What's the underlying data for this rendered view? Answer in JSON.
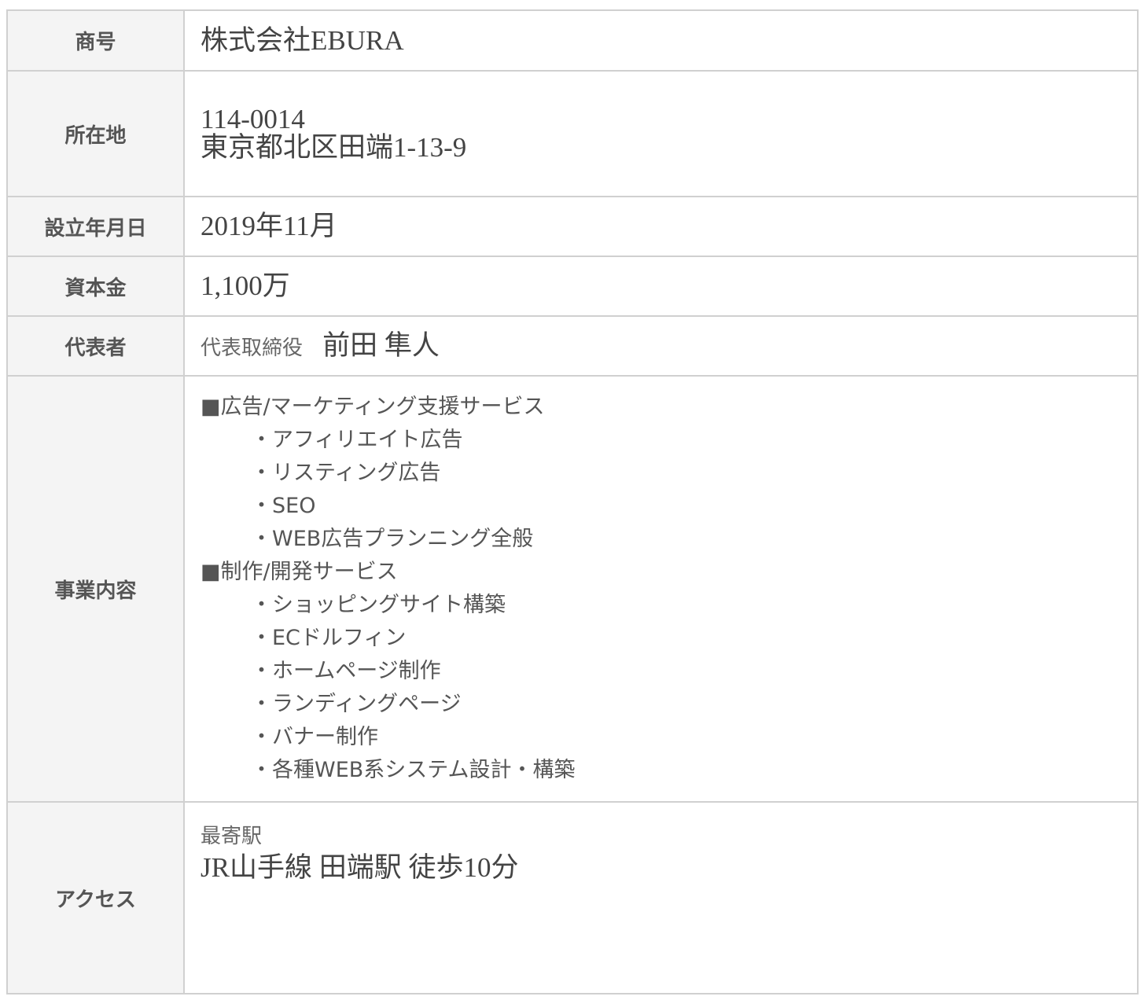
{
  "rows": {
    "name": {
      "label": "商号",
      "value": "株式会社EBURA"
    },
    "address": {
      "label": "所在地",
      "postal": "114-0014",
      "street": "東京都北区田端1-13-9"
    },
    "founded": {
      "label": "設立年月日",
      "value": "2019年11月"
    },
    "capital": {
      "label": "資本金",
      "value": "1,100万"
    },
    "representative": {
      "label": "代表者",
      "title": "代表取締役",
      "name": "前田 隼人"
    },
    "business": {
      "label": "事業内容",
      "items": [
        "■広告/マーケティング支援サービス",
        "・アフィリエイト広告",
        "・リスティング広告",
        "・SEO",
        "・WEB広告プランニング全般",
        "■制作/開発サービス",
        "・ショッピングサイト構築",
        "・ECドルフィン",
        "・ホームページ制作",
        "・ランディングページ",
        "・バナー制作",
        "・各種WEB系システム設計・構築"
      ]
    },
    "access": {
      "label": "アクセス",
      "caption": "最寄駅",
      "value": "JR山手線 田端駅 徒歩10分"
    }
  }
}
